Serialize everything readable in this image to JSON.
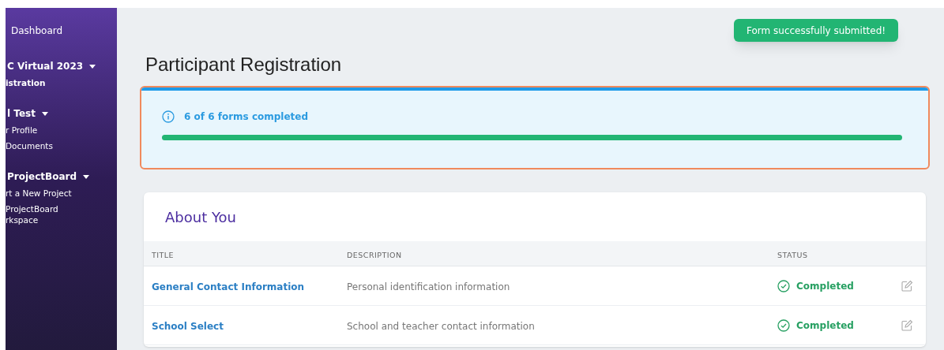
{
  "sidebar": {
    "top_link": "Dashboard",
    "sections": [
      {
        "heading": "C Virtual 2023",
        "expanded": true,
        "items": [
          "istration"
        ]
      },
      {
        "heading": "l Test",
        "expanded": true,
        "items": [
          "r Profile",
          "Documents"
        ]
      },
      {
        "heading": "ProjectBoard",
        "expanded": true,
        "items": [
          "rt a New Project",
          "ProjectBoard\nrkspace"
        ]
      }
    ]
  },
  "toast": "Form successfully submitted!",
  "page_title": "Participant Registration",
  "progress": {
    "text": "6 of 6 forms completed",
    "level": 1
  },
  "section": {
    "title": "About You",
    "columns": [
      "TITLE",
      "DESCRIPTION",
      "STATUS"
    ],
    "rows": [
      {
        "title": "General Contact Information",
        "description": "Personal identification information",
        "status": "Completed",
        "completed": true
      },
      {
        "title": "School Select",
        "description": "School and teacher contact information",
        "status": "Completed",
        "completed": true
      }
    ]
  }
}
